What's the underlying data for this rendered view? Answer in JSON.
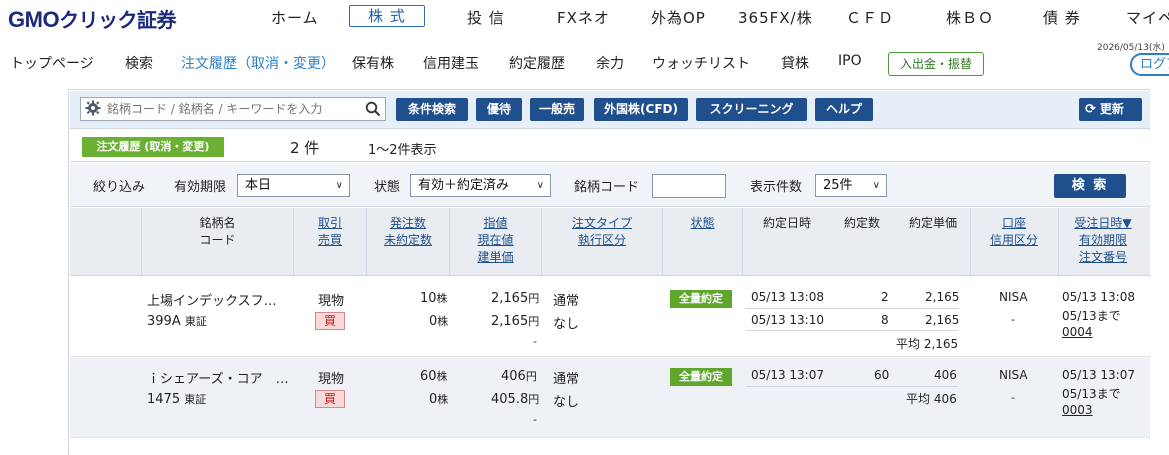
{
  "header": {
    "logo_main": "GMO",
    "logo_sub": "クリック証券",
    "nav": [
      {
        "label": "ホーム"
      },
      {
        "label": "株 式"
      },
      {
        "label": "投 信"
      },
      {
        "label": "FXネオ"
      },
      {
        "label": "外為OP"
      },
      {
        "label": "365FX/株"
      },
      {
        "label": "ＣＦＤ"
      },
      {
        "label": "株ＢＯ"
      },
      {
        "label": "債 券"
      },
      {
        "label": "マイペ"
      }
    ]
  },
  "subnav": {
    "items": [
      {
        "label": "トップページ"
      },
      {
        "label": "検索"
      },
      {
        "label": "注文履歴（取消・変更）"
      },
      {
        "label": "保有株"
      },
      {
        "label": "信用建玉"
      },
      {
        "label": "約定履歴"
      },
      {
        "label": "余力"
      },
      {
        "label": "ウォッチリスト"
      },
      {
        "label": "貸株"
      },
      {
        "label": "IPO"
      }
    ],
    "deposit_button": "入出金・振替",
    "date": "2026/05/13(水)",
    "logout_button": "ログア"
  },
  "toolbar": {
    "search_placeholder": "銘柄コード / 銘柄名 / キーワードを入力",
    "buttons": [
      {
        "label": "条件検索"
      },
      {
        "label": "優待"
      },
      {
        "label": "一般売"
      },
      {
        "label": "外国株(CFD)"
      },
      {
        "label": "スクリーニング"
      },
      {
        "label": "ヘルプ"
      }
    ],
    "refresh": "更新"
  },
  "title": {
    "badge": "注文履歴 (取消・変更)",
    "count": "2 件",
    "range": "1～2件表示"
  },
  "filters": {
    "narrow_label": "絞り込み",
    "validity_label": "有効期限",
    "validity_value": "本日",
    "status_label": "状態",
    "status_value": "有効＋約定済み",
    "code_label": "銘柄コード",
    "code_value": "",
    "per_page_label": "表示件数",
    "per_page_value": "25件",
    "search_button": "検 索"
  },
  "table": {
    "headers": {
      "name_1": "銘柄名",
      "name_2": "コード",
      "trade_1": "取引",
      "trade_2": "売買",
      "qty_1": "発注数",
      "qty_2": "未約定数",
      "price_1": "指値",
      "price_2": "現在値",
      "price_3": "建単価",
      "type_1": "注文タイプ",
      "type_2": "執行区分",
      "status": "状態",
      "exec_time": "約定日時",
      "exec_qty": "約定数",
      "exec_price": "約定単価",
      "account_1": "口座",
      "account_2": "信用区分",
      "received_1": "受注日時▼",
      "received_2": "有効期限",
      "received_3": "注文番号"
    },
    "rows": [
      {
        "name": "上場インデックスフ…",
        "code": "399A",
        "market": "東証",
        "trade": "現物",
        "side": "買",
        "qty": "10",
        "qty_unit": "株",
        "unfilled": "0",
        "unfilled_unit": "株",
        "limit": "2,165",
        "limit_unit": "円",
        "current": "2,165",
        "current_unit": "円",
        "build": "-",
        "order_type": "通常",
        "exec_class": "なし",
        "status": "全量約定",
        "execs": [
          {
            "time": "05/13 13:08",
            "qty": "2",
            "price": "2,165"
          },
          {
            "time": "05/13 13:10",
            "qty": "8",
            "price": "2,165"
          }
        ],
        "avg": "平均 2,165",
        "account": "NISA",
        "margin": "-",
        "received": "05/13 13:08",
        "expiry": "05/13まで",
        "order_no": "0004"
      },
      {
        "name": "ｉシェアーズ・コア　…",
        "code": "1475",
        "market": "東証",
        "trade": "現物",
        "side": "買",
        "qty": "60",
        "qty_unit": "株",
        "unfilled": "0",
        "unfilled_unit": "株",
        "limit": "406",
        "limit_unit": "円",
        "current": "405.8",
        "current_unit": "円",
        "build": "-",
        "order_type": "通常",
        "exec_class": "なし",
        "status": "全量約定",
        "execs": [
          {
            "time": "05/13 13:07",
            "qty": "60",
            "price": "406"
          }
        ],
        "avg": "平均 406",
        "account": "NISA",
        "margin": "-",
        "received": "05/13 13:07",
        "expiry": "05/13まで",
        "order_no": "0003"
      }
    ]
  },
  "colors": {
    "primary_button": "#1f4f8c",
    "green_badge": "#6ab033",
    "buy_badge_bg": "#f8d8d8"
  },
  "icons": {
    "gear": "gear-icon",
    "search": "search-icon",
    "refresh": "refresh-icon",
    "caret": "chevron-down-icon"
  }
}
